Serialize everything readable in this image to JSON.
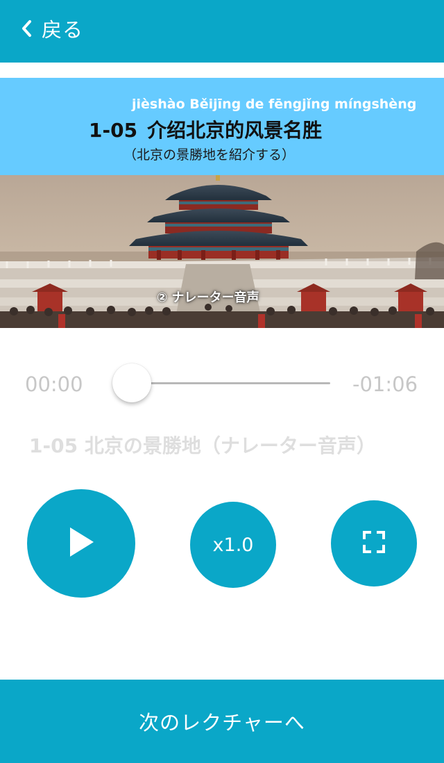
{
  "nav": {
    "back_label": "戻る",
    "back_icon": "chevron-left-icon"
  },
  "lesson": {
    "pinyin": "jièshào Běijīng de fēngjǐng míngshèng",
    "number": "1-05",
    "title": "介绍北京的风景名胜",
    "subtitle": "（北京の景勝地を紹介する）"
  },
  "photo": {
    "caption": "② ナレーター音声"
  },
  "player": {
    "current_time": "00:00",
    "remaining_time": "-01:06",
    "progress": 0.0,
    "track_title": "1-05 北京の景勝地（ナレーター音声）",
    "speed_label": "x1.0",
    "play_icon": "play-icon",
    "fullscreen_icon": "fullscreen-icon"
  },
  "footer": {
    "next_label": "次のレクチャーへ"
  },
  "colors": {
    "accent": "#0aa7c8",
    "banner": "#66cbff",
    "muted_text": "#c7c7c7",
    "track_title": "#dedede"
  }
}
